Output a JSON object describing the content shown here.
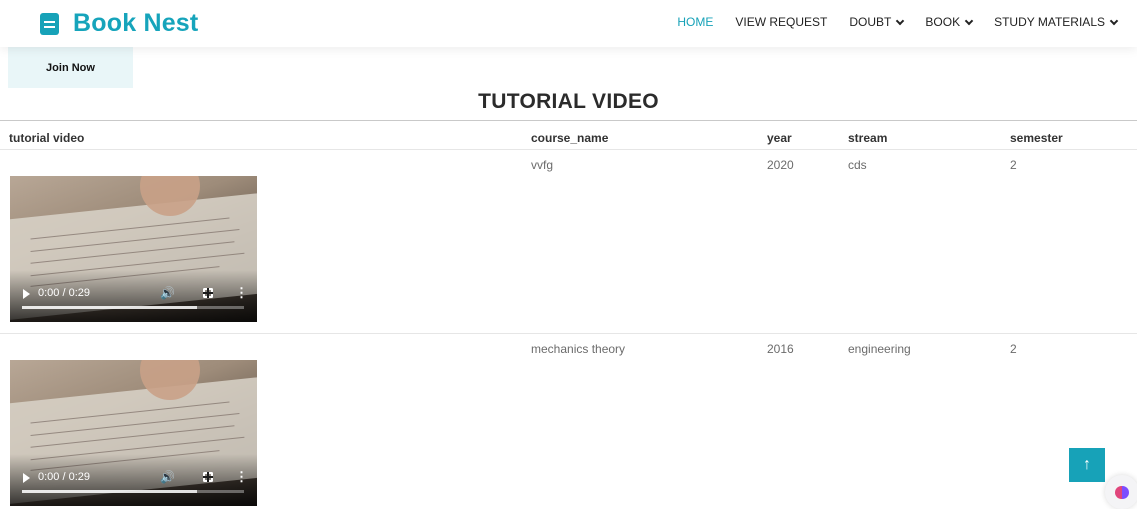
{
  "brand": {
    "name": "Book Nest",
    "color": "#16a4bb"
  },
  "nav": {
    "items": [
      {
        "label": "HOME",
        "active": true,
        "dropdown": false
      },
      {
        "label": "VIEW REQUEST",
        "active": false,
        "dropdown": false
      },
      {
        "label": "DOUBT",
        "active": false,
        "dropdown": true
      },
      {
        "label": "BOOK",
        "active": false,
        "dropdown": true
      },
      {
        "label": "STUDY MATERIALS",
        "active": false,
        "dropdown": true
      }
    ]
  },
  "join_label": "Join Now",
  "page_title": "TUTORIAL VIDEO",
  "table": {
    "headers": [
      "tutorial video",
      "course_name",
      "year",
      "stream",
      "semester"
    ],
    "rows": [
      {
        "video": {
          "time": "0:00 / 0:29",
          "buffered": 0.79
        },
        "course_name": "vvfg",
        "year": "2020",
        "stream": "cds",
        "semester": "2"
      },
      {
        "video": {
          "time": "0:00 / 0:29",
          "buffered": 0.79
        },
        "course_name": "mechanics theory",
        "year": "2016",
        "stream": "engineering",
        "semester": "2"
      }
    ]
  },
  "back_to_top": "↑",
  "icons": {
    "back_to_top": "arrow-up-icon",
    "assistant": "brain-icon",
    "logo": "book-icon"
  },
  "accent_color": "#17a2b8"
}
